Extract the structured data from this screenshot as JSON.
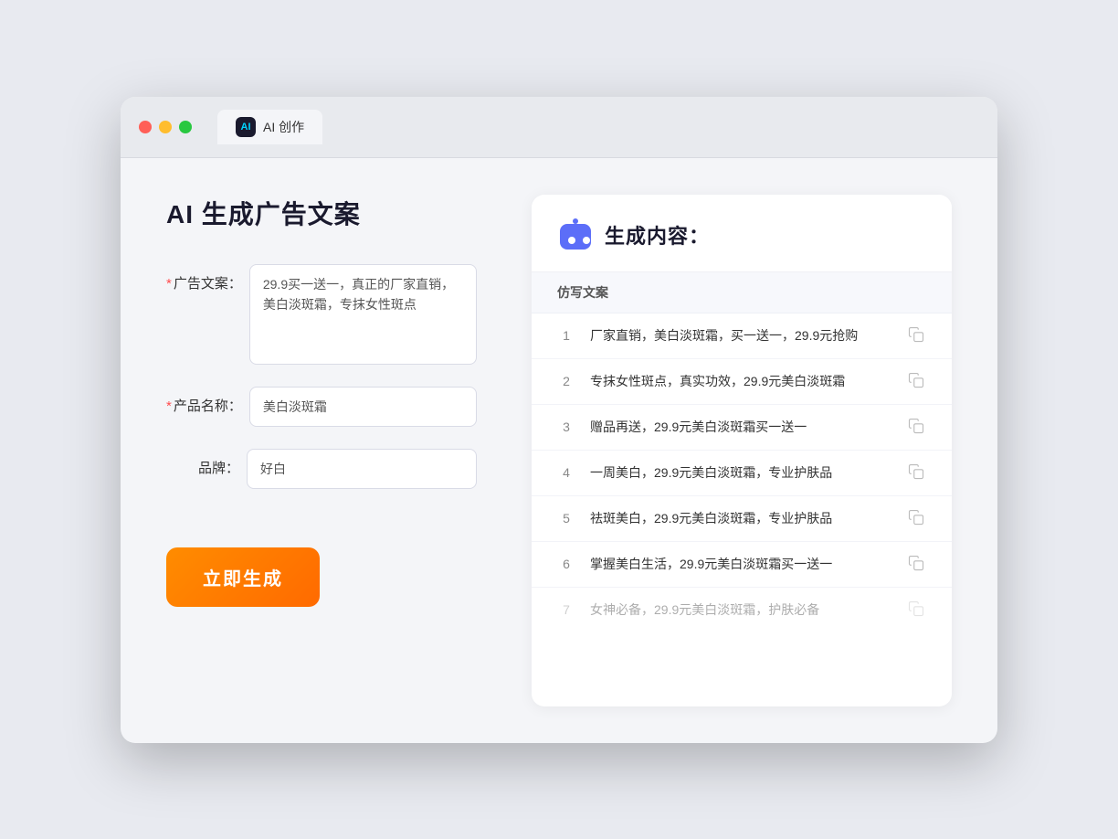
{
  "window": {
    "tab_label": "AI 创作",
    "tab_icon_text": "AI"
  },
  "left_panel": {
    "title": "AI 生成广告文案",
    "fields": [
      {
        "label": "广告文案：",
        "required": true,
        "type": "textarea",
        "value": "29.9买一送一，真正的厂家直销，美白淡斑霜，专抹女性斑点",
        "data_name": "ad-copy-field"
      },
      {
        "label": "产品名称：",
        "required": true,
        "type": "input",
        "value": "美白淡斑霜",
        "data_name": "product-name-field"
      },
      {
        "label": "品牌：",
        "required": false,
        "type": "input",
        "value": "好白",
        "data_name": "brand-field"
      }
    ],
    "button_label": "立即生成"
  },
  "right_panel": {
    "title": "生成内容：",
    "robot_icon": "robot",
    "table_header": "仿写文案",
    "results": [
      {
        "num": "1",
        "text": "厂家直销，美白淡斑霜，买一送一，29.9元抢购",
        "faded": false
      },
      {
        "num": "2",
        "text": "专抹女性斑点，真实功效，29.9元美白淡斑霜",
        "faded": false
      },
      {
        "num": "3",
        "text": "赠品再送，29.9元美白淡斑霜买一送一",
        "faded": false
      },
      {
        "num": "4",
        "text": "一周美白，29.9元美白淡斑霜，专业护肤品",
        "faded": false
      },
      {
        "num": "5",
        "text": "祛斑美白，29.9元美白淡斑霜，专业护肤品",
        "faded": false
      },
      {
        "num": "6",
        "text": "掌握美白生活，29.9元美白淡斑霜买一送一",
        "faded": false
      },
      {
        "num": "7",
        "text": "女神必备，29.9元美白淡斑霜，护肤必备",
        "faded": true
      }
    ]
  }
}
